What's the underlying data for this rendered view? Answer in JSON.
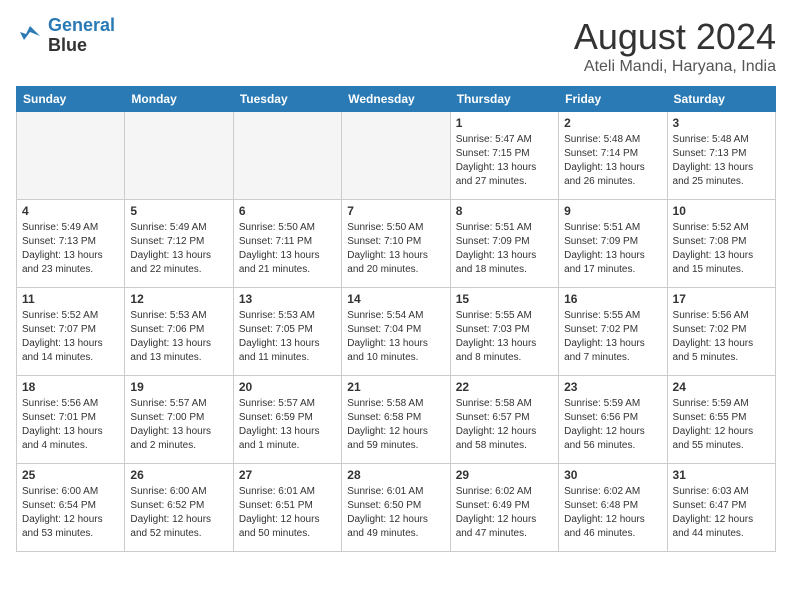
{
  "logo": {
    "line1": "General",
    "line2": "Blue"
  },
  "title": "August 2024",
  "location": "Ateli Mandi, Haryana, India",
  "days_of_week": [
    "Sunday",
    "Monday",
    "Tuesday",
    "Wednesday",
    "Thursday",
    "Friday",
    "Saturday"
  ],
  "weeks": [
    [
      {
        "day": "",
        "sunrise": "",
        "sunset": "",
        "daylight": "",
        "empty": true
      },
      {
        "day": "",
        "sunrise": "",
        "sunset": "",
        "daylight": "",
        "empty": true
      },
      {
        "day": "",
        "sunrise": "",
        "sunset": "",
        "daylight": "",
        "empty": true
      },
      {
        "day": "",
        "sunrise": "",
        "sunset": "",
        "daylight": "",
        "empty": true
      },
      {
        "day": "1",
        "sunrise": "Sunrise: 5:47 AM",
        "sunset": "Sunset: 7:15 PM",
        "daylight": "Daylight: 13 hours and 27 minutes.",
        "empty": false
      },
      {
        "day": "2",
        "sunrise": "Sunrise: 5:48 AM",
        "sunset": "Sunset: 7:14 PM",
        "daylight": "Daylight: 13 hours and 26 minutes.",
        "empty": false
      },
      {
        "day": "3",
        "sunrise": "Sunrise: 5:48 AM",
        "sunset": "Sunset: 7:13 PM",
        "daylight": "Daylight: 13 hours and 25 minutes.",
        "empty": false
      }
    ],
    [
      {
        "day": "4",
        "sunrise": "Sunrise: 5:49 AM",
        "sunset": "Sunset: 7:13 PM",
        "daylight": "Daylight: 13 hours and 23 minutes.",
        "empty": false
      },
      {
        "day": "5",
        "sunrise": "Sunrise: 5:49 AM",
        "sunset": "Sunset: 7:12 PM",
        "daylight": "Daylight: 13 hours and 22 minutes.",
        "empty": false
      },
      {
        "day": "6",
        "sunrise": "Sunrise: 5:50 AM",
        "sunset": "Sunset: 7:11 PM",
        "daylight": "Daylight: 13 hours and 21 minutes.",
        "empty": false
      },
      {
        "day": "7",
        "sunrise": "Sunrise: 5:50 AM",
        "sunset": "Sunset: 7:10 PM",
        "daylight": "Daylight: 13 hours and 20 minutes.",
        "empty": false
      },
      {
        "day": "8",
        "sunrise": "Sunrise: 5:51 AM",
        "sunset": "Sunset: 7:09 PM",
        "daylight": "Daylight: 13 hours and 18 minutes.",
        "empty": false
      },
      {
        "day": "9",
        "sunrise": "Sunrise: 5:51 AM",
        "sunset": "Sunset: 7:09 PM",
        "daylight": "Daylight: 13 hours and 17 minutes.",
        "empty": false
      },
      {
        "day": "10",
        "sunrise": "Sunrise: 5:52 AM",
        "sunset": "Sunset: 7:08 PM",
        "daylight": "Daylight: 13 hours and 15 minutes.",
        "empty": false
      }
    ],
    [
      {
        "day": "11",
        "sunrise": "Sunrise: 5:52 AM",
        "sunset": "Sunset: 7:07 PM",
        "daylight": "Daylight: 13 hours and 14 minutes.",
        "empty": false
      },
      {
        "day": "12",
        "sunrise": "Sunrise: 5:53 AM",
        "sunset": "Sunset: 7:06 PM",
        "daylight": "Daylight: 13 hours and 13 minutes.",
        "empty": false
      },
      {
        "day": "13",
        "sunrise": "Sunrise: 5:53 AM",
        "sunset": "Sunset: 7:05 PM",
        "daylight": "Daylight: 13 hours and 11 minutes.",
        "empty": false
      },
      {
        "day": "14",
        "sunrise": "Sunrise: 5:54 AM",
        "sunset": "Sunset: 7:04 PM",
        "daylight": "Daylight: 13 hours and 10 minutes.",
        "empty": false
      },
      {
        "day": "15",
        "sunrise": "Sunrise: 5:55 AM",
        "sunset": "Sunset: 7:03 PM",
        "daylight": "Daylight: 13 hours and 8 minutes.",
        "empty": false
      },
      {
        "day": "16",
        "sunrise": "Sunrise: 5:55 AM",
        "sunset": "Sunset: 7:02 PM",
        "daylight": "Daylight: 13 hours and 7 minutes.",
        "empty": false
      },
      {
        "day": "17",
        "sunrise": "Sunrise: 5:56 AM",
        "sunset": "Sunset: 7:02 PM",
        "daylight": "Daylight: 13 hours and 5 minutes.",
        "empty": false
      }
    ],
    [
      {
        "day": "18",
        "sunrise": "Sunrise: 5:56 AM",
        "sunset": "Sunset: 7:01 PM",
        "daylight": "Daylight: 13 hours and 4 minutes.",
        "empty": false
      },
      {
        "day": "19",
        "sunrise": "Sunrise: 5:57 AM",
        "sunset": "Sunset: 7:00 PM",
        "daylight": "Daylight: 13 hours and 2 minutes.",
        "empty": false
      },
      {
        "day": "20",
        "sunrise": "Sunrise: 5:57 AM",
        "sunset": "Sunset: 6:59 PM",
        "daylight": "Daylight: 13 hours and 1 minute.",
        "empty": false
      },
      {
        "day": "21",
        "sunrise": "Sunrise: 5:58 AM",
        "sunset": "Sunset: 6:58 PM",
        "daylight": "Daylight: 12 hours and 59 minutes.",
        "empty": false
      },
      {
        "day": "22",
        "sunrise": "Sunrise: 5:58 AM",
        "sunset": "Sunset: 6:57 PM",
        "daylight": "Daylight: 12 hours and 58 minutes.",
        "empty": false
      },
      {
        "day": "23",
        "sunrise": "Sunrise: 5:59 AM",
        "sunset": "Sunset: 6:56 PM",
        "daylight": "Daylight: 12 hours and 56 minutes.",
        "empty": false
      },
      {
        "day": "24",
        "sunrise": "Sunrise: 5:59 AM",
        "sunset": "Sunset: 6:55 PM",
        "daylight": "Daylight: 12 hours and 55 minutes.",
        "empty": false
      }
    ],
    [
      {
        "day": "25",
        "sunrise": "Sunrise: 6:00 AM",
        "sunset": "Sunset: 6:54 PM",
        "daylight": "Daylight: 12 hours and 53 minutes.",
        "empty": false
      },
      {
        "day": "26",
        "sunrise": "Sunrise: 6:00 AM",
        "sunset": "Sunset: 6:52 PM",
        "daylight": "Daylight: 12 hours and 52 minutes.",
        "empty": false
      },
      {
        "day": "27",
        "sunrise": "Sunrise: 6:01 AM",
        "sunset": "Sunset: 6:51 PM",
        "daylight": "Daylight: 12 hours and 50 minutes.",
        "empty": false
      },
      {
        "day": "28",
        "sunrise": "Sunrise: 6:01 AM",
        "sunset": "Sunset: 6:50 PM",
        "daylight": "Daylight: 12 hours and 49 minutes.",
        "empty": false
      },
      {
        "day": "29",
        "sunrise": "Sunrise: 6:02 AM",
        "sunset": "Sunset: 6:49 PM",
        "daylight": "Daylight: 12 hours and 47 minutes.",
        "empty": false
      },
      {
        "day": "30",
        "sunrise": "Sunrise: 6:02 AM",
        "sunset": "Sunset: 6:48 PM",
        "daylight": "Daylight: 12 hours and 46 minutes.",
        "empty": false
      },
      {
        "day": "31",
        "sunrise": "Sunrise: 6:03 AM",
        "sunset": "Sunset: 6:47 PM",
        "daylight": "Daylight: 12 hours and 44 minutes.",
        "empty": false
      }
    ]
  ]
}
